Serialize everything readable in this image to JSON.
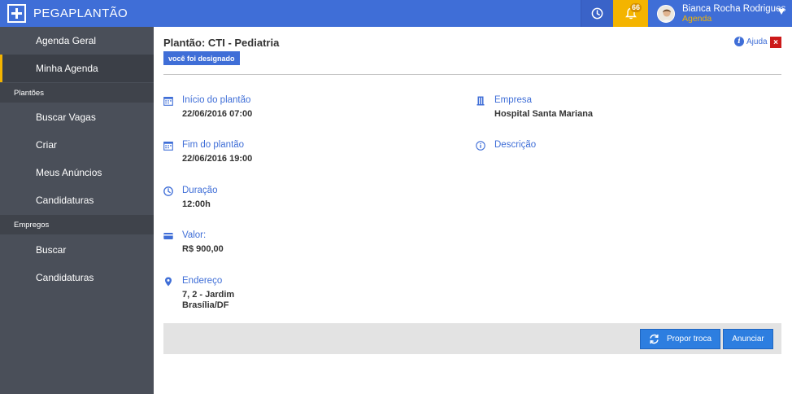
{
  "app": {
    "brand": "PEGAPLANTÃO",
    "brand_icon": "plus-square-icon",
    "accent_color": "#3f6ed7",
    "highlight_color": "#f4b400"
  },
  "topbar": {
    "notifications_count": "66",
    "user_name": "Bianca Rocha Rodrigues",
    "user_role": "Agenda"
  },
  "sidebar": {
    "items_top": [
      {
        "label": "Agenda Geral",
        "active": false
      },
      {
        "label": "Minha Agenda",
        "active": true
      }
    ],
    "section_plantoes": "Plantões",
    "items_plantoes": [
      {
        "label": "Buscar Vagas"
      },
      {
        "label": "Criar"
      },
      {
        "label": "Meus Anúncios"
      },
      {
        "label": "Candidaturas"
      }
    ],
    "section_empregos": "Empregos",
    "items_empregos": [
      {
        "label": "Buscar"
      },
      {
        "label": "Candidaturas"
      }
    ]
  },
  "main": {
    "title": "Plantão: CTI - Pediatria",
    "badge": "você foi designado",
    "help_label": "Ajuda",
    "close_label": "×",
    "fields": {
      "inicio": {
        "label": "Início do plantão",
        "value": "22/06/2016 07:00",
        "icon": "calendar-icon"
      },
      "fim": {
        "label": "Fim do plantão",
        "value": "22/06/2016 19:00",
        "icon": "calendar-icon"
      },
      "duracao": {
        "label": "Duração",
        "value": "12:00h",
        "icon": "clock-icon"
      },
      "valor": {
        "label": "Valor:",
        "value": "R$ 900,00",
        "icon": "credit-card-icon"
      },
      "endereco": {
        "label": "Endereço",
        "value_line1": "7, 2 - Jardim",
        "value_line2": "Brasília/DF",
        "icon": "map-pin-icon"
      },
      "empresa": {
        "label": "Empresa",
        "value": "Hospital Santa Mariana",
        "icon": "building-icon"
      },
      "descricao": {
        "label": "Descrição",
        "icon": "info-icon"
      }
    },
    "buttons": {
      "propor_troca": "Propor troca",
      "anunciar": "Anunciar"
    }
  }
}
